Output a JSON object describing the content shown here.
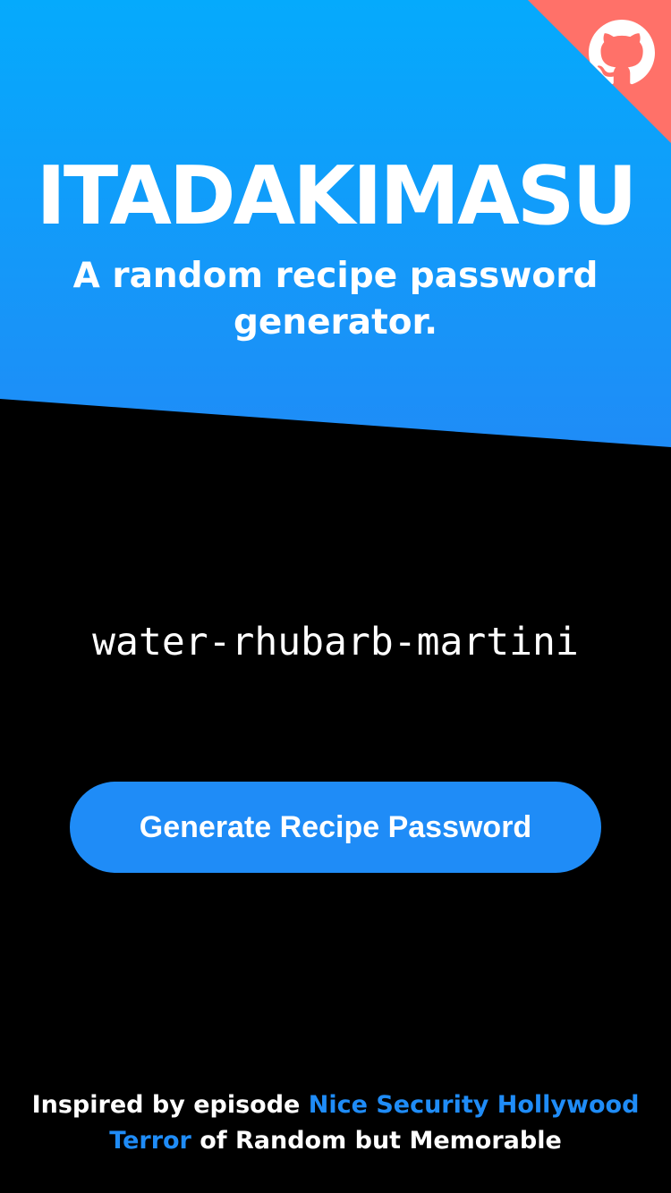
{
  "header": {
    "title": "ITADAKIMASU",
    "subtitle": "A random recipe password generator."
  },
  "corner_link": {
    "icon": "github-octocat-icon",
    "colors": {
      "background": "#ff7169",
      "icon": "#ffffff"
    }
  },
  "password": {
    "value": "water-rhubarb-martini"
  },
  "generate_button": {
    "label": "Generate Recipe Password"
  },
  "footer": {
    "prefix": "Inspired by episode ",
    "episode_link": "Nice Security Hollywood Terror",
    "suffix": " of Random but Memorable"
  },
  "colors": {
    "hero_top": "#05aafc",
    "hero_bottom": "#1f8cf7",
    "accent": "#1f8cf7",
    "background": "#000000",
    "text": "#ffffff"
  }
}
